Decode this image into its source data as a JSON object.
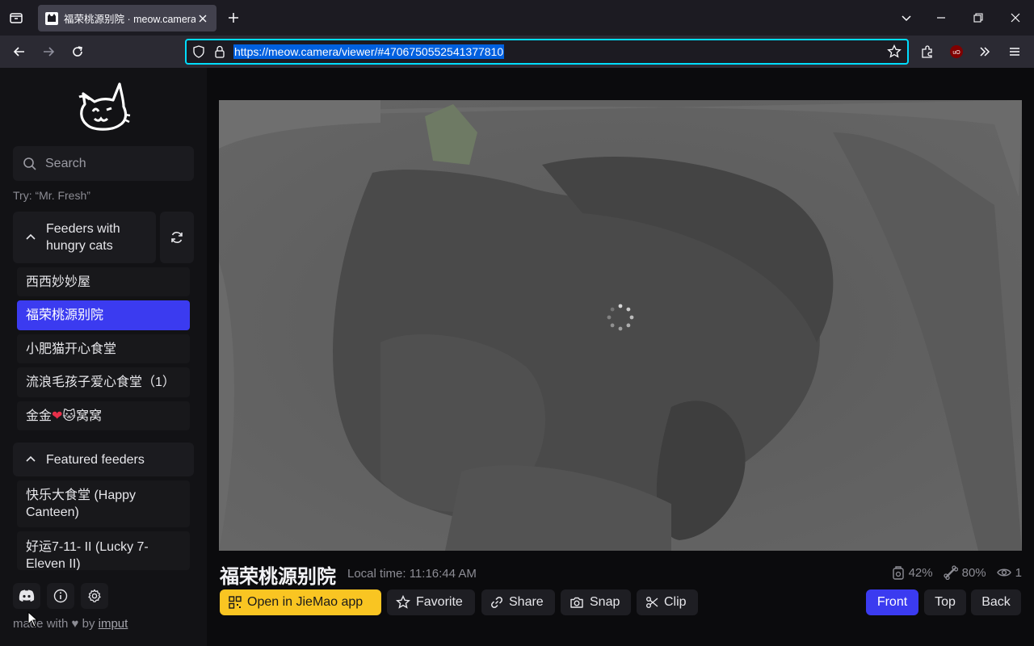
{
  "browser": {
    "tab_title": "福荣桃源别院 · meow.camera",
    "url": "https://meow.camera/viewer/#4706750552541377810",
    "accent": "#00ddff",
    "icons": [
      "tab-list-icon",
      "close-icon",
      "plus-icon",
      "chevron-down-icon",
      "minimize-icon",
      "restore-icon",
      "window-close-icon",
      "back-icon",
      "forward-icon",
      "reload-icon",
      "shield-icon",
      "lock-icon",
      "star-icon",
      "extensions-icon",
      "ublock-icon",
      "overflow-icon",
      "menu-icon"
    ]
  },
  "sidebar": {
    "search_placeholder": "Search",
    "search_hint": "Try: “Mr. Fresh”",
    "hungry_section": {
      "label_line1": "Feeders with",
      "label_line2": "hungry cats",
      "items": [
        "西西妙妙屋",
        "福荣桃源别院",
        "小肥猫开心食堂",
        "流浪毛孩子爱心食堂（1）"
      ],
      "item5_prefix": "金金",
      "item5_suffix": "窝窝",
      "active_index": 1
    },
    "featured_section": {
      "label": "Featured feeders",
      "items": [
        {
          "line1": "快乐大食堂 (Happy",
          "line2": "Canteen)"
        },
        {
          "line1": "好运7-11- II (Lucky 7-",
          "line2": "Eleven II)"
        }
      ]
    },
    "footer": {
      "made_with": "made with",
      "by": "by",
      "author": "imput"
    },
    "accent": "#3b3bf0"
  },
  "viewer": {
    "camera_name": "福荣桃源别院",
    "local_time": "Local time: 11:16:44 AM",
    "food_level": "42%",
    "battery_level": "80%",
    "viewers": "1",
    "buttons": {
      "open_app": "Open in JieMao app",
      "favorite": "Favorite",
      "share": "Share",
      "snap": "Snap",
      "clip": "Clip",
      "front": "Front",
      "top": "Top",
      "back": "Back"
    },
    "primary_color": "#f9c522"
  }
}
